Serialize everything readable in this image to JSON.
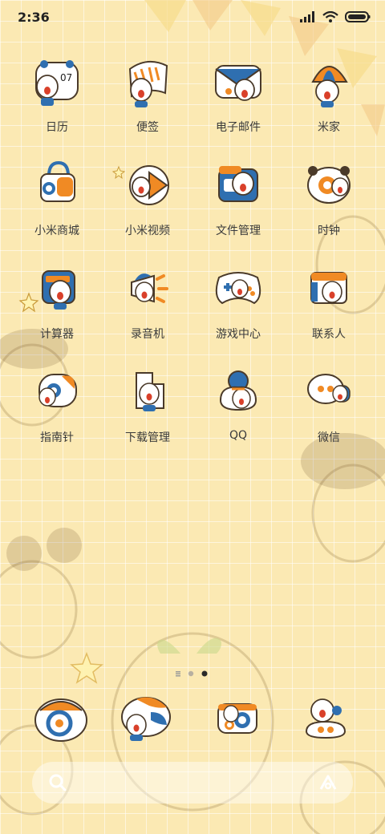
{
  "status_bar": {
    "time": "2:36",
    "signal_icon": "signal-icon",
    "wifi_icon": "wifi-icon",
    "battery_icon": "battery-icon"
  },
  "apps": [
    {
      "label": "日历",
      "icon": "calendar-icon",
      "badge": "07"
    },
    {
      "label": "便签",
      "icon": "notes-icon"
    },
    {
      "label": "电子邮件",
      "icon": "email-icon"
    },
    {
      "label": "米家",
      "icon": "mijia-icon"
    },
    {
      "label": "小米商城",
      "icon": "mi-store-icon"
    },
    {
      "label": "小米视频",
      "icon": "mi-video-icon"
    },
    {
      "label": "文件管理",
      "icon": "file-manager-icon"
    },
    {
      "label": "时钟",
      "icon": "clock-icon"
    },
    {
      "label": "计算器",
      "icon": "calculator-icon"
    },
    {
      "label": "录音机",
      "icon": "recorder-icon"
    },
    {
      "label": "游戏中心",
      "icon": "game-center-icon"
    },
    {
      "label": "联系人",
      "icon": "contacts-icon"
    },
    {
      "label": "指南针",
      "icon": "compass-icon"
    },
    {
      "label": "下载管理",
      "icon": "downloads-icon"
    },
    {
      "label": "QQ",
      "icon": "qq-icon"
    },
    {
      "label": "微信",
      "icon": "wechat-icon"
    }
  ],
  "pager": {
    "pages": 3,
    "current": 3
  },
  "dock": [
    {
      "icon": "phone-icon"
    },
    {
      "icon": "messages-icon"
    },
    {
      "icon": "camera-icon"
    },
    {
      "icon": "browser-icon"
    }
  ],
  "search_bar": {
    "left_icon": "search-icon",
    "right_icon": "assistant-icon"
  },
  "colors": {
    "background": "#fbe9b3",
    "accent_orange": "#f08a24",
    "accent_blue": "#2f6fb0",
    "label": "#3a3a3a"
  }
}
